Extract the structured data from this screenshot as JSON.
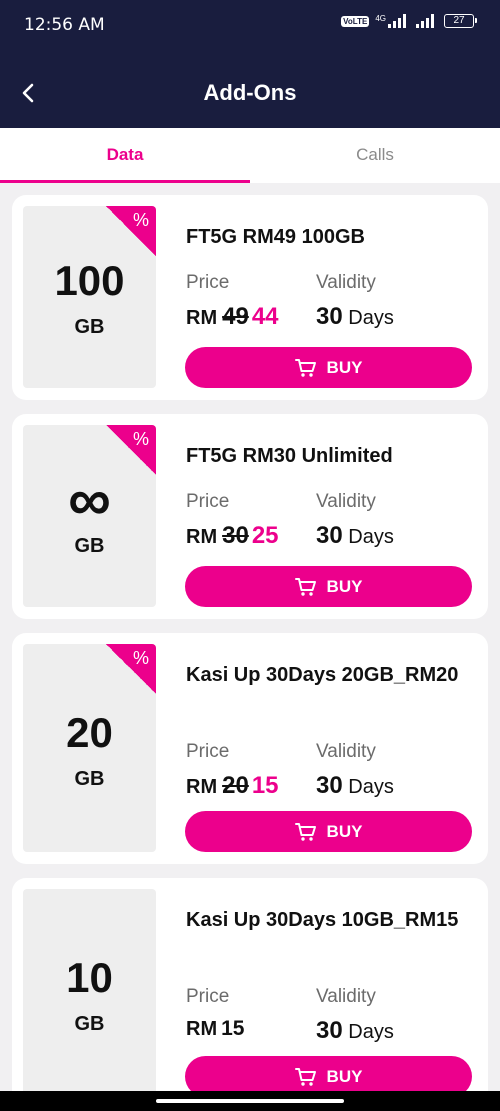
{
  "status_bar": {
    "time": "12:56 AM",
    "volte": "VoLTE",
    "network": "4G",
    "battery": "27"
  },
  "header": {
    "title": "Add-Ons"
  },
  "tabs": [
    {
      "label": "Data",
      "active": true
    },
    {
      "label": "Calls",
      "active": false
    }
  ],
  "price_label": "Price",
  "validity_label": "Validity",
  "currency": "RM",
  "buy_label": "BUY",
  "promo_symbol": "%",
  "plans": [
    {
      "name": "FT5G RM49 100GB",
      "capacity": "100",
      "unit": "GB",
      "old_price": "49",
      "price": "44",
      "validity_num": "30",
      "validity_unit": "Days",
      "promo": true
    },
    {
      "name": "FT5G RM30 Unlimited",
      "capacity": "∞",
      "unit": "GB",
      "old_price": "30",
      "price": "25",
      "validity_num": "30",
      "validity_unit": "Days",
      "promo": true
    },
    {
      "name": "Kasi Up 30Days 20GB_RM20",
      "capacity": "20",
      "unit": "GB",
      "old_price": "20",
      "price": "15",
      "validity_num": "30",
      "validity_unit": "Days",
      "promo": true
    },
    {
      "name": "Kasi Up 30Days 10GB_RM15",
      "capacity": "10",
      "unit": "GB",
      "price": "15",
      "validity_num": "30",
      "validity_unit": "Days",
      "promo": false
    }
  ],
  "colors": {
    "accent": "#ec008c",
    "header_bg": "#191d3e",
    "page_bg": "#f1f0f2"
  }
}
